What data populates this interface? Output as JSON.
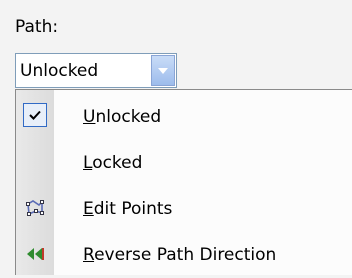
{
  "path_label": "Path:",
  "combo": {
    "value": "Unlocked"
  },
  "menu": {
    "items": [
      {
        "prefix": "",
        "mnemonic": "U",
        "rest": "nlocked",
        "checked": true,
        "icon": "checkmark-icon"
      },
      {
        "prefix": "",
        "mnemonic": "L",
        "rest": "ocked",
        "checked": false,
        "icon": ""
      },
      {
        "prefix": "",
        "mnemonic": "E",
        "rest": "dit Points",
        "checked": false,
        "icon": "edit-points-icon"
      },
      {
        "prefix": "",
        "mnemonic": "R",
        "rest": "everse Path Direction",
        "checked": false,
        "icon": "reverse-path-icon"
      }
    ]
  },
  "colors": {
    "accent": "#316ac5",
    "dropdown_button": "#9dbcec",
    "edit_points_icon": "#5a6bb5",
    "reverse_path_icon": "#2e8b2e"
  }
}
